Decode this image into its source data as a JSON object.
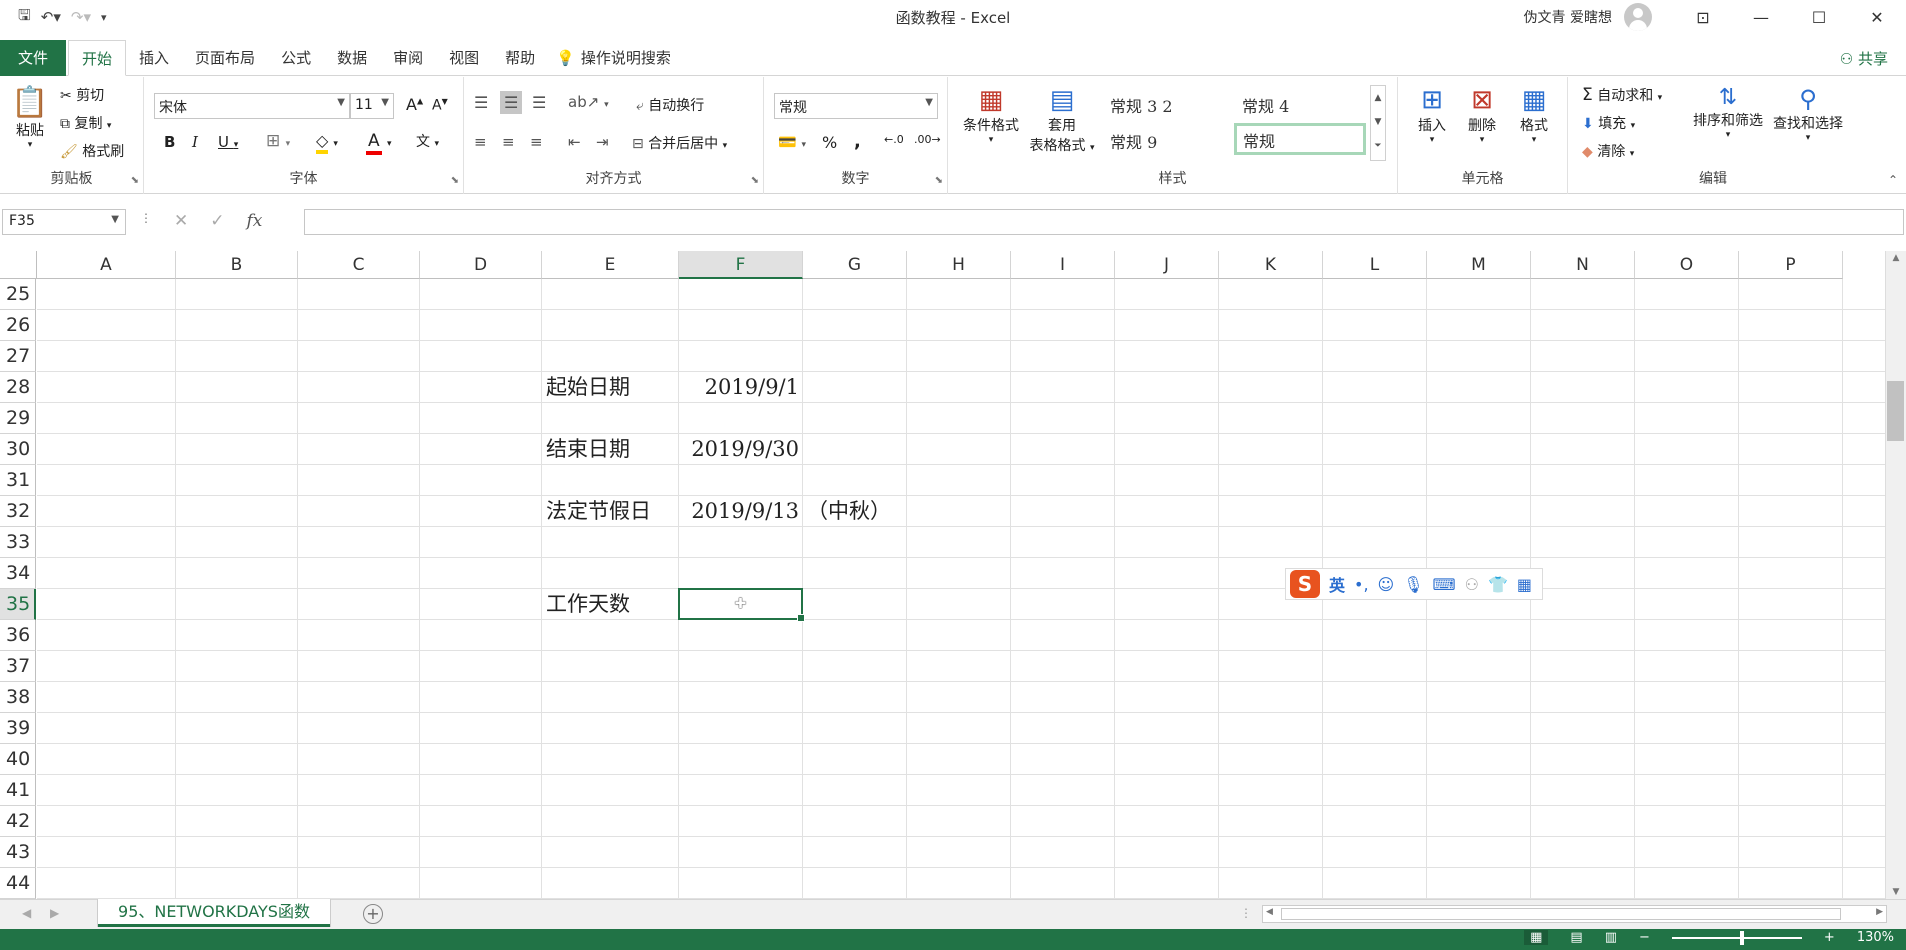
{
  "window": {
    "title": "函数教程  -  Excel",
    "user": "伪文青 爱瞎想",
    "buttons": [
      "restore-ribbon",
      "minimize",
      "maximize",
      "close"
    ]
  },
  "tabs": {
    "file": "文件",
    "items": [
      "开始",
      "插入",
      "页面布局",
      "公式",
      "数据",
      "审阅",
      "视图",
      "帮助"
    ],
    "active": "开始",
    "tell_me": "操作说明搜索",
    "share": "共享"
  },
  "ribbon": {
    "clipboard": {
      "label": "剪贴板",
      "paste": "粘贴",
      "cut": "剪切",
      "copy": "复制",
      "painter": "格式刷"
    },
    "font": {
      "label": "字体",
      "name": "宋体",
      "size": "11",
      "bold": "B",
      "italic": "I",
      "underline": "U",
      "grow": "A",
      "shrink": "A",
      "font_color": "A",
      "phonetic": "文"
    },
    "alignment": {
      "label": "对齐方式",
      "wrap": "自动换行",
      "merge": "合并后居中"
    },
    "number": {
      "label": "数字",
      "format": "常规",
      "percent": "%",
      "comma": ","
    },
    "styles": {
      "label": "样式",
      "conditional": "条件格式",
      "table_line1": "套用",
      "table_line2": "表格格式",
      "cells": [
        "常规 3 2",
        "常规 4",
        "常规 9",
        "常规"
      ]
    },
    "cells": {
      "label": "单元格",
      "insert": "插入",
      "delete": "删除",
      "format": "格式"
    },
    "editing": {
      "label": "编辑",
      "autosum": "自动求和",
      "fill": "填充",
      "clear": "清除",
      "sort": "排序和筛选",
      "find": "查找和选择"
    }
  },
  "formula_bar": {
    "name_box": "F35",
    "fx": "fx",
    "content": ""
  },
  "grid": {
    "columns": [
      "A",
      "B",
      "C",
      "D",
      "E",
      "F",
      "G",
      "H",
      "I",
      "J",
      "K",
      "L",
      "M",
      "N",
      "O",
      "P"
    ],
    "rows": [
      "25",
      "26",
      "27",
      "28",
      "29",
      "30",
      "31",
      "32",
      "33",
      "34",
      "35",
      "36",
      "37",
      "38",
      "39",
      "40",
      "41",
      "42",
      "43",
      "44"
    ],
    "selected_column": "F",
    "selected_row": "35",
    "cells": {
      "E28": "起始日期",
      "F28": "2019/9/1",
      "E30": "结束日期",
      "F30": "2019/9/30",
      "E32": "法定节假日",
      "F32": "2019/9/13",
      "G32": "（中秋）",
      "E35": "工作天数",
      "F35": ""
    }
  },
  "ime": {
    "logo": "S",
    "lang": "英"
  },
  "sheets": {
    "active": "95、NETWORKDAYS函数"
  },
  "status": {
    "zoom": "130%"
  }
}
